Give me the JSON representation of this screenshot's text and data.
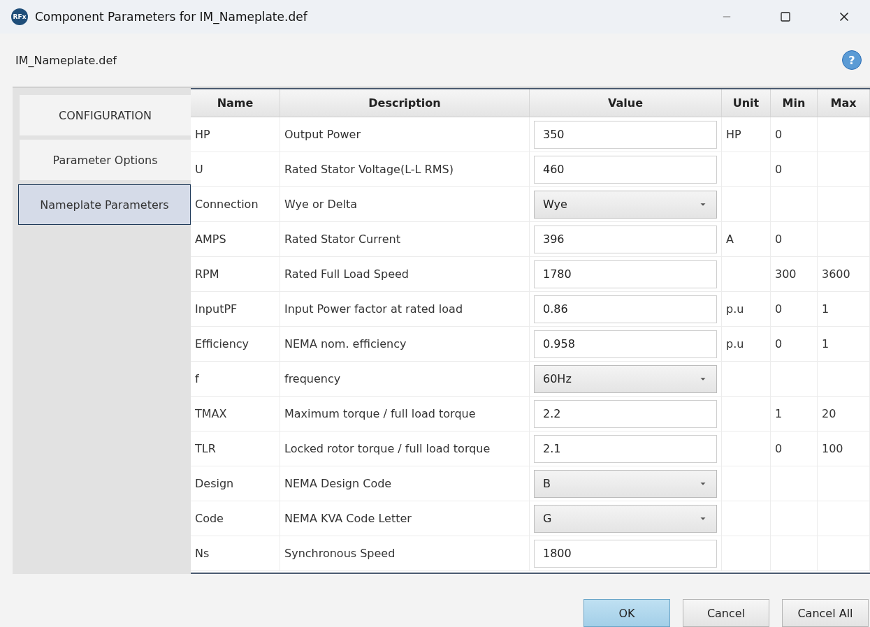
{
  "window": {
    "title": "Component Parameters for IM_Nameplate.def",
    "logo": "RFx"
  },
  "subtitle": "IM_Nameplate.def",
  "help": "?",
  "tabs": [
    {
      "label": "CONFIGURATION",
      "selected": false
    },
    {
      "label": "Parameter Options",
      "selected": false
    },
    {
      "label": "Nameplate Parameters",
      "selected": true
    }
  ],
  "table": {
    "columns": [
      "Name",
      "Description",
      "Value",
      "Unit",
      "Min",
      "Max"
    ],
    "rows": [
      {
        "name": "HP",
        "description": "Output Power",
        "kind": "text",
        "value": "350",
        "unit": "HP",
        "min": "0",
        "max": ""
      },
      {
        "name": "U",
        "description": "Rated Stator Voltage(L-L RMS)",
        "kind": "text",
        "value": "460",
        "unit": "",
        "min": "0",
        "max": ""
      },
      {
        "name": "Connection",
        "description": "Wye or Delta",
        "kind": "select",
        "value": "Wye",
        "unit": "",
        "min": "",
        "max": ""
      },
      {
        "name": "AMPS",
        "description": "Rated Stator Current",
        "kind": "text",
        "value": "396",
        "unit": "A",
        "min": "0",
        "max": ""
      },
      {
        "name": "RPM",
        "description": "Rated Full Load Speed",
        "kind": "text",
        "value": "1780",
        "unit": "",
        "min": "300",
        "max": "3600"
      },
      {
        "name": "InputPF",
        "description": "Input Power factor at rated load",
        "kind": "text",
        "value": "0.86",
        "unit": "p.u",
        "min": "0",
        "max": "1"
      },
      {
        "name": "Efficiency",
        "description": "NEMA nom. efficiency",
        "kind": "text",
        "value": "0.958",
        "unit": "p.u",
        "min": "0",
        "max": "1"
      },
      {
        "name": "f",
        "description": "frequency",
        "kind": "select",
        "value": "60Hz",
        "unit": "",
        "min": "",
        "max": ""
      },
      {
        "name": "TMAX",
        "description": "Maximum torque / full load torque",
        "kind": "text",
        "value": "2.2",
        "unit": "",
        "min": "1",
        "max": "20"
      },
      {
        "name": "TLR",
        "description": "Locked rotor torque / full load torque",
        "kind": "text",
        "value": "2.1",
        "unit": "",
        "min": "0",
        "max": "100"
      },
      {
        "name": "Design",
        "description": "NEMA Design Code",
        "kind": "select",
        "value": "B",
        "unit": "",
        "min": "",
        "max": ""
      },
      {
        "name": "Code",
        "description": "NEMA KVA Code Letter",
        "kind": "select",
        "value": "G",
        "unit": "",
        "min": "",
        "max": ""
      },
      {
        "name": "Ns",
        "description": "Synchronous Speed",
        "kind": "text",
        "value": "1800",
        "unit": "",
        "min": "",
        "max": ""
      }
    ]
  },
  "buttons": [
    {
      "label": "OK",
      "primary": true
    },
    {
      "label": "Cancel",
      "primary": false
    },
    {
      "label": "Cancel All",
      "primary": false
    }
  ]
}
